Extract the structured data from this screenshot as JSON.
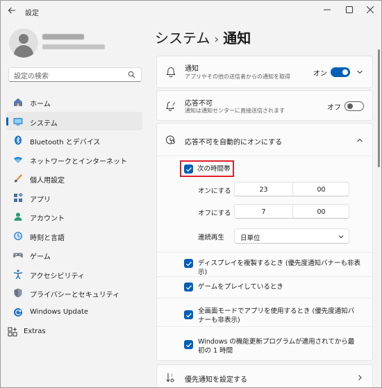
{
  "window": {
    "title": "設定"
  },
  "search": {
    "placeholder": "設定の検索"
  },
  "nav": {
    "items": [
      {
        "label": "ホーム",
        "icon": "home-icon"
      },
      {
        "label": "システム",
        "icon": "system-icon",
        "selected": true
      },
      {
        "label": "Bluetooth とデバイス",
        "icon": "bluetooth-icon"
      },
      {
        "label": "ネットワークとインターネット",
        "icon": "network-icon"
      },
      {
        "label": "個人用設定",
        "icon": "personalization-icon"
      },
      {
        "label": "アプリ",
        "icon": "apps-icon"
      },
      {
        "label": "アカウント",
        "icon": "account-icon"
      },
      {
        "label": "時刻と言語",
        "icon": "time-language-icon"
      },
      {
        "label": "ゲーム",
        "icon": "gaming-icon"
      },
      {
        "label": "アクセシビリティ",
        "icon": "accessibility-icon"
      },
      {
        "label": "プライバシーとセキュリティ",
        "icon": "privacy-icon"
      },
      {
        "label": "Windows Update",
        "icon": "windows-update-icon"
      }
    ],
    "extras": "Extras"
  },
  "header": {
    "parent": "システム",
    "separator": "›",
    "current": "通知"
  },
  "notifications": {
    "title": "通知",
    "subtitle": "アプリやその他の送信者からの通知を取得",
    "state_label": "オン"
  },
  "dnd": {
    "title": "応答不可",
    "subtitle": "通知は通知センターに直接送信されます",
    "state_label": "オフ"
  },
  "auto_dnd": {
    "title": "応答不可を自動的にオンにする",
    "time_window": {
      "label": "次の時間帯",
      "on_label": "オンにする",
      "on_hour": "23",
      "on_minute": "00",
      "off_label": "オフにする",
      "off_hour": "7",
      "off_minute": "00",
      "repeat_label": "連続再生",
      "repeat_value": "日単位"
    },
    "duplicate_display": "ディスプレイを複製するとき (優先度通知バナーも非表示)",
    "gaming": "ゲームをプレイしているとき",
    "fullscreen": "全画面モードでアプリを使用するとき (優先度通知バナーも非表示)",
    "windows_update": "Windows の機能更新プログラムが適用されてから最初の 1 時間"
  },
  "priority": {
    "title": "優先通知を設定する"
  },
  "colors": {
    "accent": "#005fb8",
    "highlight": "#e0202a"
  }
}
